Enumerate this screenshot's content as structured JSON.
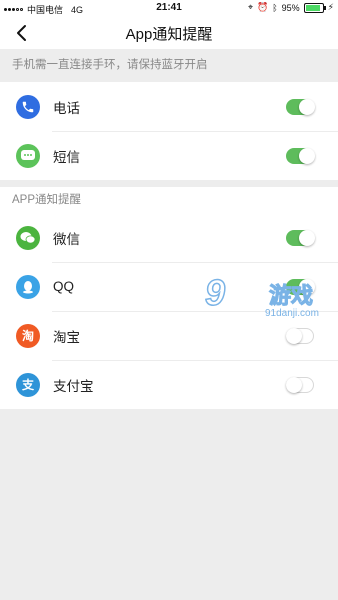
{
  "status": {
    "carrier": "中国电信",
    "network": "4G",
    "time": "21:41",
    "battery_pct": "95%",
    "battery_level": 0.95
  },
  "nav": {
    "title": "App通知提醒"
  },
  "notice": "手机需一直连接手环，请保持蓝牙开启",
  "section1": [
    {
      "label": "电话",
      "icon": "phone-icon",
      "color": "#2f6de1",
      "on": true
    },
    {
      "label": "短信",
      "icon": "message-icon",
      "color": "#5cc35a",
      "on": true
    }
  ],
  "section2_title": "APP通知提醒",
  "section2": [
    {
      "label": "微信",
      "icon": "wechat-icon",
      "color": "#4bb43f",
      "on": true
    },
    {
      "label": "QQ",
      "icon": "qq-icon",
      "color": "#3aa3e6",
      "on": true
    },
    {
      "label": "淘宝",
      "icon": "taobao-icon",
      "color": "#f05a24",
      "on": false
    },
    {
      "label": "支付宝",
      "icon": "alipay-icon",
      "color": "#2e94d8",
      "on": false
    }
  ],
  "watermark": {
    "logo": "9",
    "text": "游戏",
    "url": "91danji.com"
  },
  "colors": {
    "toggle_on": "#5ebc5c",
    "background": "#ededed"
  }
}
